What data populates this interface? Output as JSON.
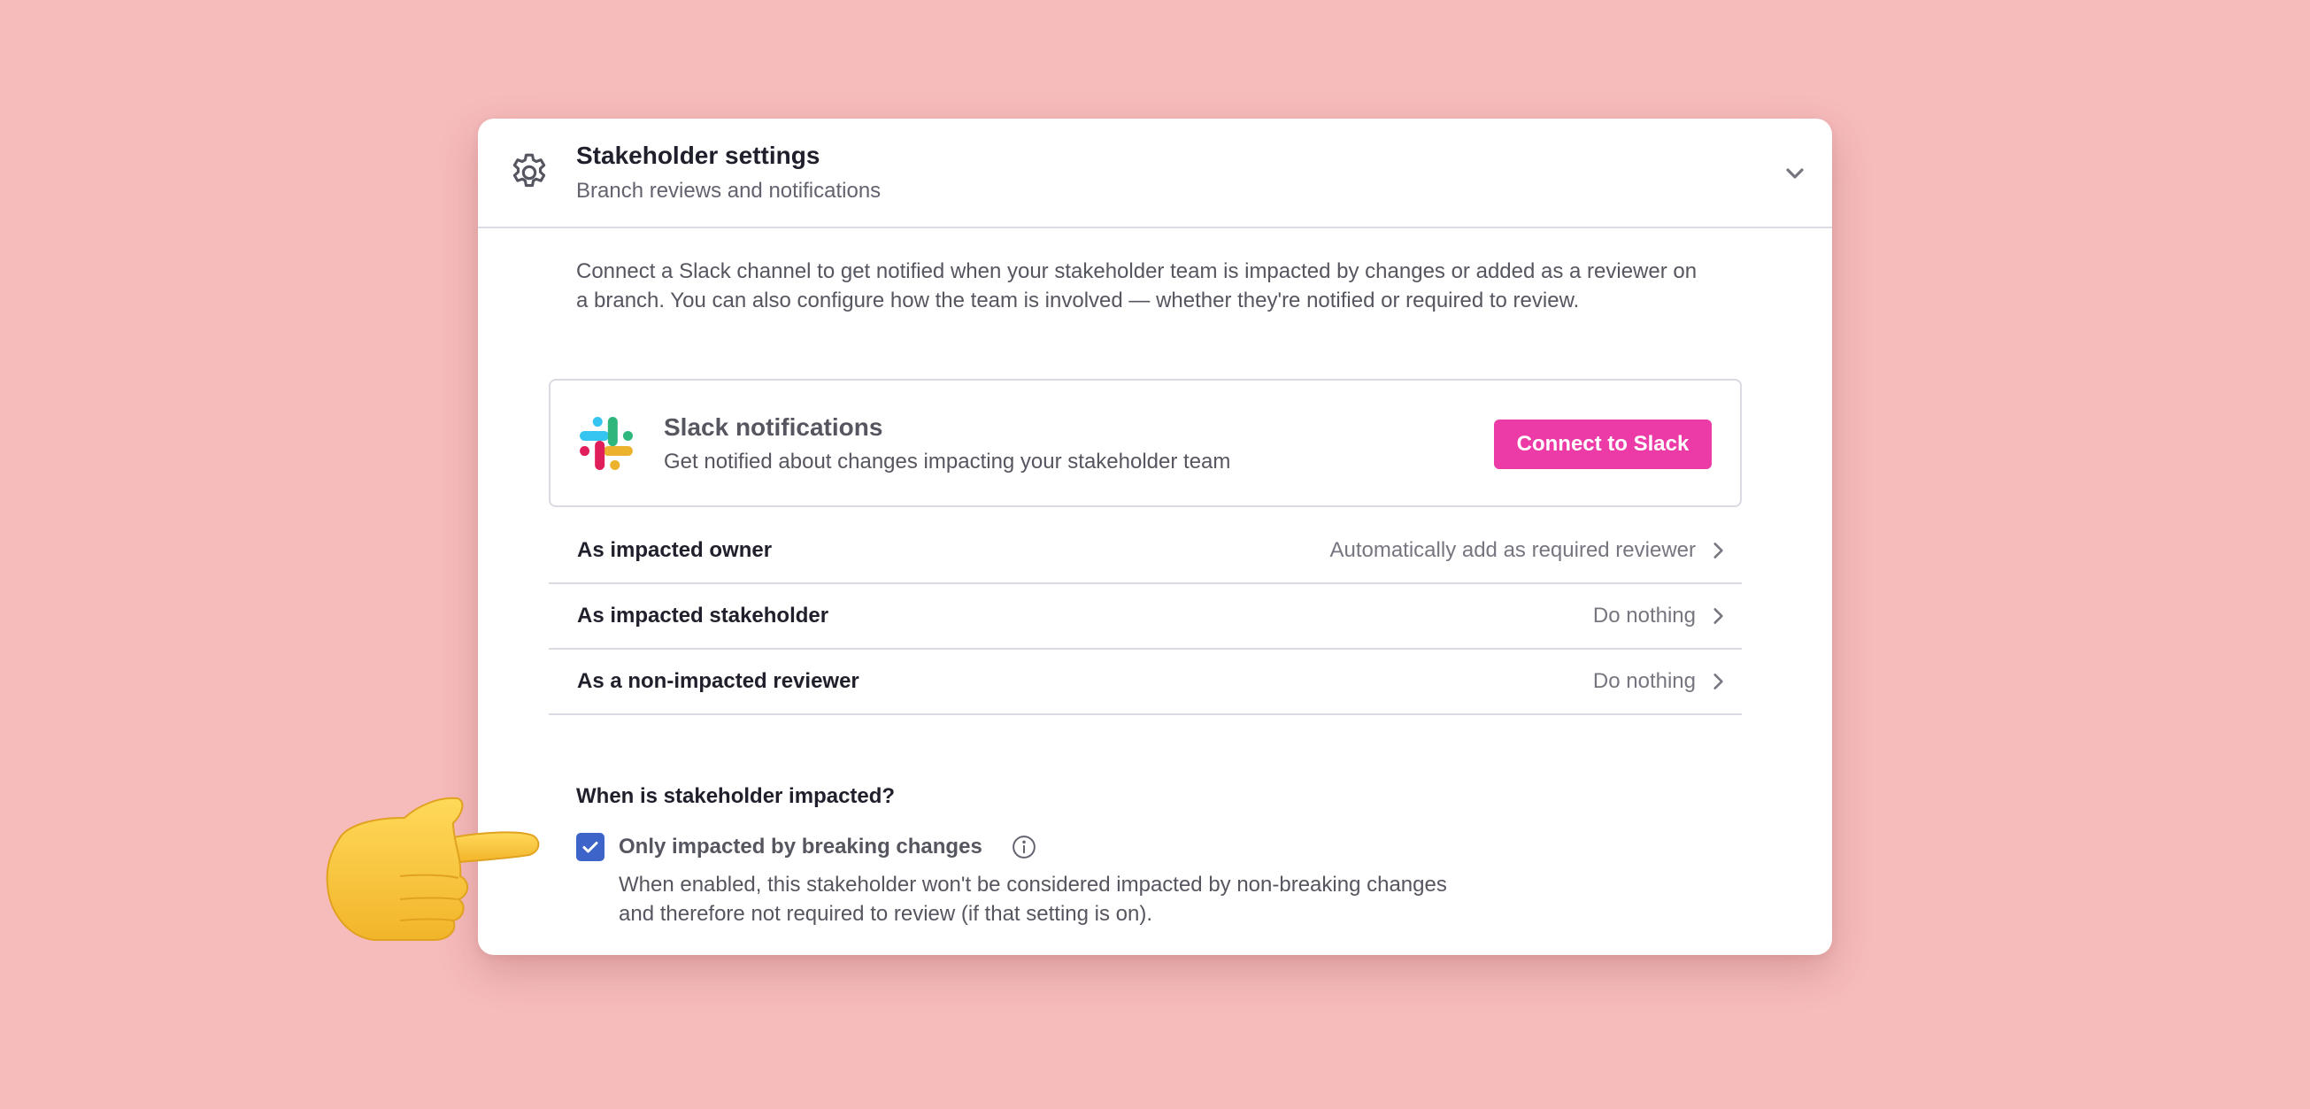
{
  "header": {
    "title": "Stakeholder settings",
    "subtitle": "Branch reviews and notifications",
    "icon": "gear-icon",
    "toggle_icon": "chevron-down-icon"
  },
  "description": "Connect a Slack channel to get notified when your stakeholder team is impacted by changes or added as a reviewer on a branch. You can also configure how the team is involved — whether they're notified or required to review.",
  "slack": {
    "title": "Slack notifications",
    "subtitle": "Get notified about changes impacting your stakeholder team",
    "button_label": "Connect to Slack",
    "icon": "slack-logo-icon"
  },
  "rows": [
    {
      "label": "As impacted owner",
      "value": "Automatically add as required reviewer"
    },
    {
      "label": "As impacted stakeholder",
      "value": "Do nothing"
    },
    {
      "label": "As a non-impacted reviewer",
      "value": "Do nothing"
    }
  ],
  "impact": {
    "title": "When is stakeholder impacted?",
    "checkbox_label": "Only impacted by breaking changes",
    "checked": true,
    "help": "When enabled, this stakeholder won't be considered impacted by non-breaking changes and therefore not required to review (if that setting is on)."
  },
  "colors": {
    "background": "#f6bbbb",
    "accent_button": "#ec3aa6",
    "checkbox": "#3d64c8"
  }
}
